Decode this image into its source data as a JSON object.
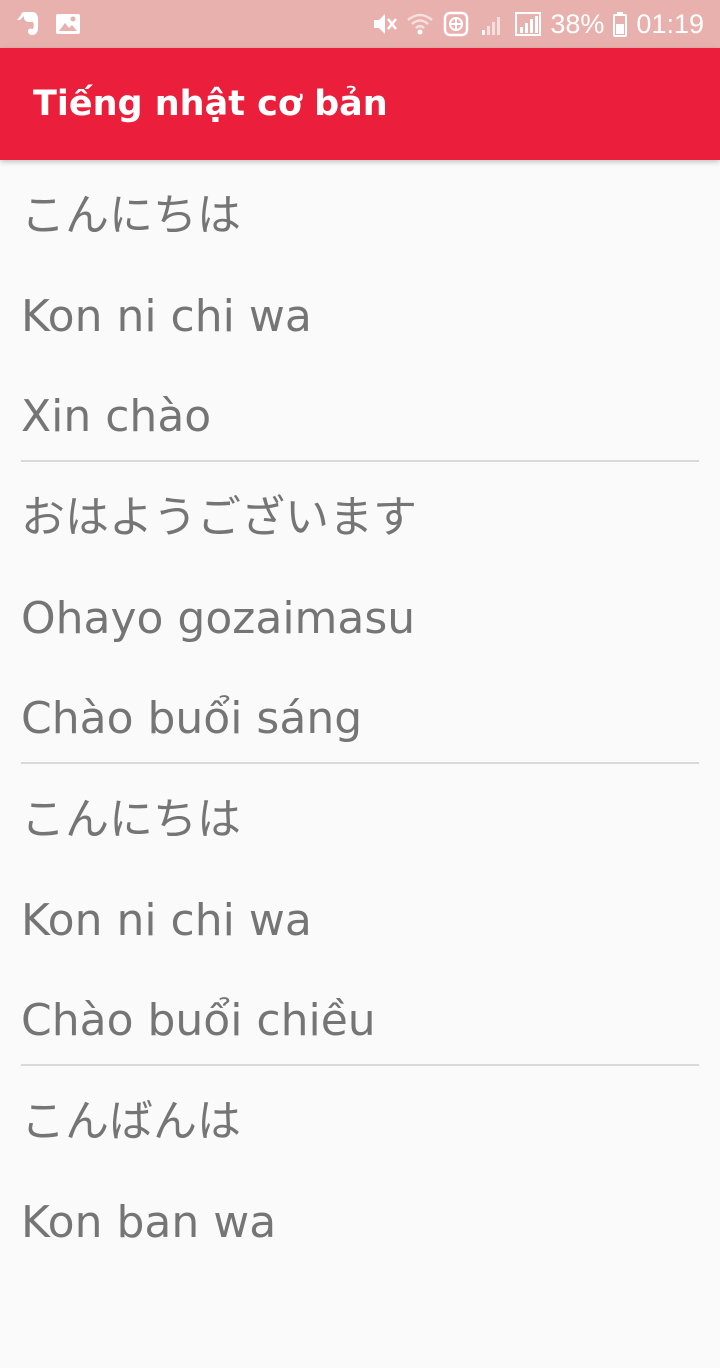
{
  "status_bar": {
    "battery_text": "38%",
    "time": "01:19",
    "left_icons": [
      "evernote-icon",
      "image-icon"
    ],
    "right_icons": [
      "mute-icon",
      "wifi-icon",
      "vpn-icon",
      "signal-icon",
      "signal-full-icon",
      "battery-icon"
    ]
  },
  "app_bar": {
    "title": "Tiếng nhật cơ bản",
    "color": "#eb1e3b"
  },
  "phrases": [
    {
      "japanese": "こんにちは",
      "romaji": "Kon ni chi wa",
      "vietnamese": "Xin chào"
    },
    {
      "japanese": "おはようございます",
      "romaji": "Ohayo gozaimasu",
      "vietnamese": "Chào buổi sáng"
    },
    {
      "japanese": "こんにちは",
      "romaji": "Kon ni chi wa",
      "vietnamese": "Chào buổi chiều"
    },
    {
      "japanese": "こんばんは",
      "romaji": "Kon ban wa",
      "vietnamese": ""
    }
  ]
}
